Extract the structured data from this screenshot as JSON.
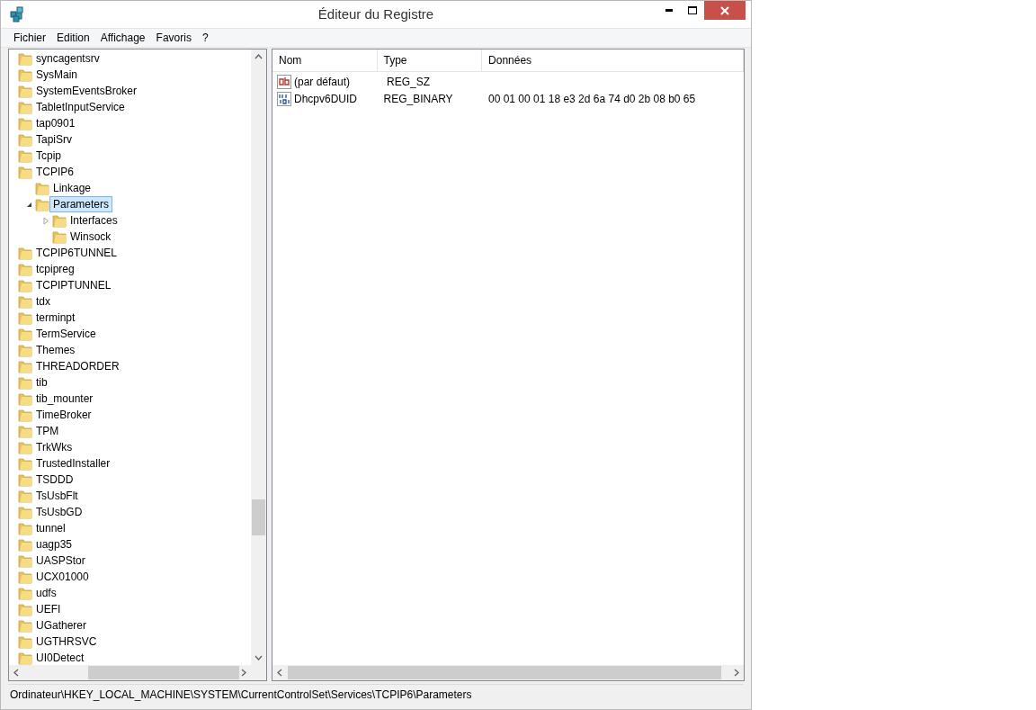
{
  "window": {
    "title": "Éditeur du Registre"
  },
  "menu": [
    "Fichier",
    "Edition",
    "Affichage",
    "Favoris",
    "?"
  ],
  "tree": [
    {
      "label": "syncagentsrv",
      "selected": false
    },
    {
      "label": "SysMain",
      "selected": false
    },
    {
      "label": "SystemEventsBroker",
      "selected": false
    },
    {
      "label": "TabletInputService",
      "selected": false
    },
    {
      "label": "tap0901",
      "selected": false
    },
    {
      "label": "TapiSrv",
      "selected": false
    },
    {
      "label": "Tcpip",
      "selected": false
    },
    {
      "label": "TCPIP6",
      "selected": false,
      "children": [
        {
          "label": "Linkage",
          "selected": false
        },
        {
          "label": "Parameters",
          "selected": true,
          "expanded": true,
          "children": [
            {
              "label": "Interfaces",
              "selected": false,
              "expanded": false
            },
            {
              "label": "Winsock",
              "selected": false
            }
          ]
        }
      ]
    },
    {
      "label": "TCPIP6TUNNEL",
      "selected": false
    },
    {
      "label": "tcpipreg",
      "selected": false
    },
    {
      "label": "TCPIPTUNNEL",
      "selected": false
    },
    {
      "label": "tdx",
      "selected": false
    },
    {
      "label": "terminpt",
      "selected": false
    },
    {
      "label": "TermService",
      "selected": false
    },
    {
      "label": "Themes",
      "selected": false
    },
    {
      "label": "THREADORDER",
      "selected": false
    },
    {
      "label": "tib",
      "selected": false
    },
    {
      "label": "tib_mounter",
      "selected": false
    },
    {
      "label": "TimeBroker",
      "selected": false
    },
    {
      "label": "TPM",
      "selected": false
    },
    {
      "label": "TrkWks",
      "selected": false
    },
    {
      "label": "TrustedInstaller",
      "selected": false
    },
    {
      "label": "TSDDD",
      "selected": false
    },
    {
      "label": "TsUsbFlt",
      "selected": false
    },
    {
      "label": "TsUsbGD",
      "selected": false
    },
    {
      "label": "tunnel",
      "selected": false
    },
    {
      "label": "uagp35",
      "selected": false
    },
    {
      "label": "UASPStor",
      "selected": false
    },
    {
      "label": "UCX01000",
      "selected": false
    },
    {
      "label": "udfs",
      "selected": false
    },
    {
      "label": "UEFI",
      "selected": false
    },
    {
      "label": "UGatherer",
      "selected": false
    },
    {
      "label": "UGTHRSVC",
      "selected": false
    },
    {
      "label": "UI0Detect",
      "selected": false
    }
  ],
  "table": {
    "columns": [
      "Nom",
      "Type",
      "Données"
    ],
    "rows": [
      {
        "kind": "string",
        "name": "(par défaut)",
        "type": "REG_SZ"
      },
      {
        "kind": "binary",
        "name": "Dhcpv6DUID",
        "type": "REG_BINARY",
        "data": "00 01 00 01 18 e3 2d 6a 74 d0 2b 08 b0 65"
      }
    ]
  },
  "status_bar": "Ordinateur\\HKEY_LOCAL_MACHINE\\SYSTEM\\CurrentControlSet\\Services\\TCPIP6\\Parameters"
}
